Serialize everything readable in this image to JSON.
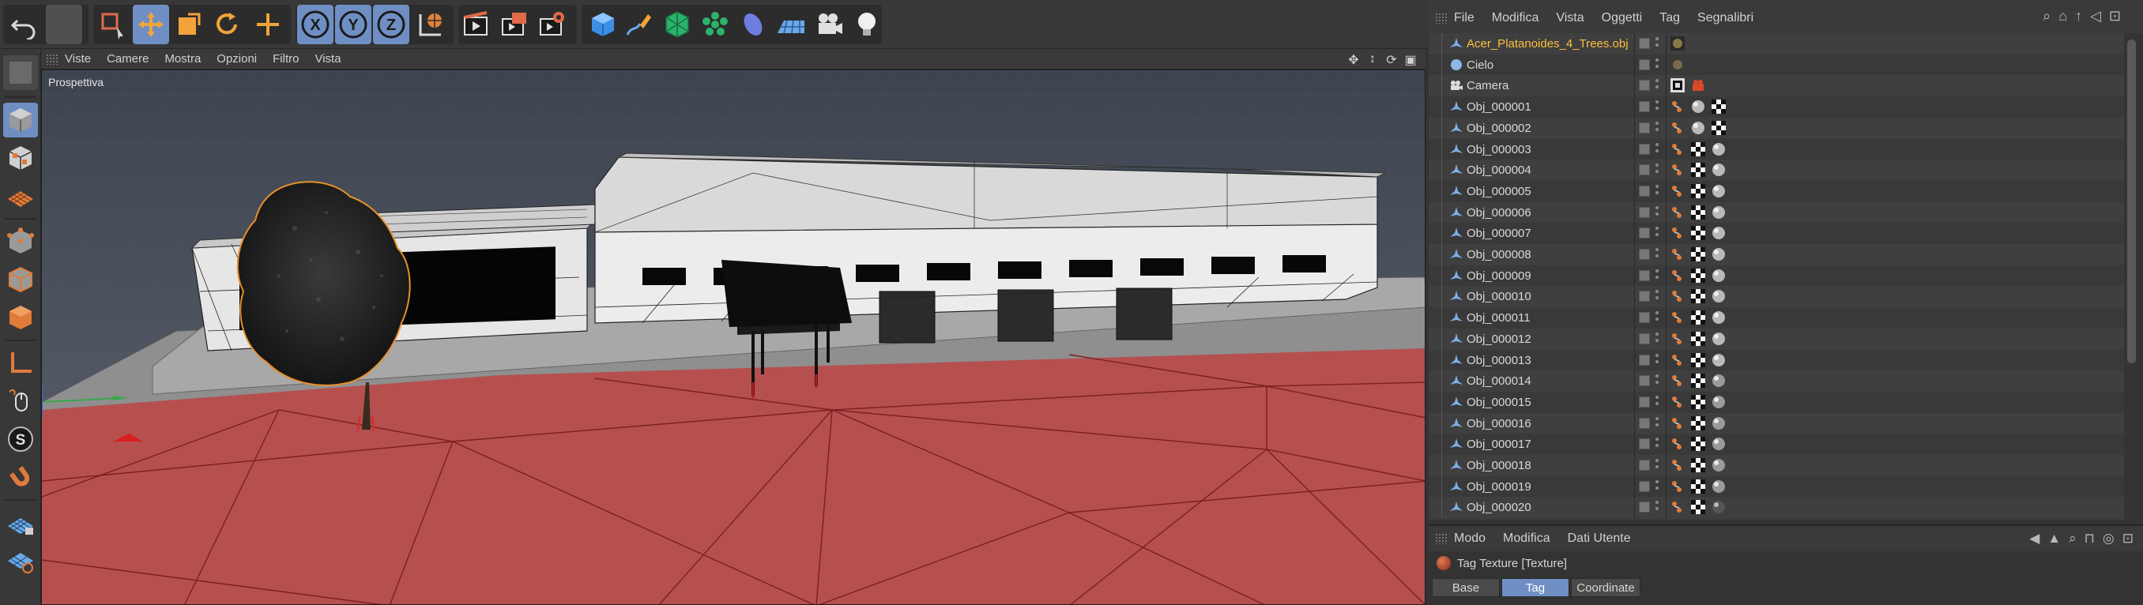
{
  "viewport": {
    "menu": [
      "Viste",
      "Camere",
      "Mostra",
      "Opzioni",
      "Filtro",
      "Vista"
    ],
    "label": "Prospettiva"
  },
  "object_manager": {
    "menu": [
      "File",
      "Modifica",
      "Vista",
      "Oggetti",
      "Tag",
      "Segnalibri"
    ],
    "objects": [
      {
        "name": "Acer_Platanoides_4_Trees.obj",
        "selected": true,
        "icon": "null-object-icon",
        "tags": [
          "texture-preview-icon"
        ]
      },
      {
        "name": "Cielo",
        "selected": false,
        "icon": "sky-icon",
        "tags": [
          "sky-texture-icon"
        ]
      },
      {
        "name": "Camera",
        "selected": false,
        "icon": "camera-icon",
        "tags": [
          "target-tag-icon",
          "protection-tag-icon"
        ]
      },
      {
        "name": "Obj_000001",
        "selected": false,
        "icon": "polygon-object-icon",
        "tags": [
          "phong-tag-icon",
          "material-icon",
          "checker-material-icon"
        ]
      },
      {
        "name": "Obj_000002",
        "selected": false,
        "icon": "polygon-object-icon",
        "tags": [
          "phong-tag-icon",
          "material-icon",
          "checker-material-icon"
        ]
      },
      {
        "name": "Obj_000003",
        "selected": false,
        "icon": "polygon-object-icon",
        "tags": [
          "phong-tag-icon",
          "checker-material-icon",
          "material-icon"
        ]
      },
      {
        "name": "Obj_000004",
        "selected": false,
        "icon": "polygon-object-icon",
        "tags": [
          "phong-tag-icon",
          "checker-material-icon",
          "material-icon"
        ]
      },
      {
        "name": "Obj_000005",
        "selected": false,
        "icon": "polygon-object-icon",
        "tags": [
          "phong-tag-icon",
          "checker-material-icon",
          "material-icon"
        ]
      },
      {
        "name": "Obj_000006",
        "selected": false,
        "icon": "polygon-object-icon",
        "tags": [
          "phong-tag-icon",
          "checker-material-icon",
          "material-icon"
        ]
      },
      {
        "name": "Obj_000007",
        "selected": false,
        "icon": "polygon-object-icon",
        "tags": [
          "phong-tag-icon",
          "checker-material-icon",
          "material-icon"
        ]
      },
      {
        "name": "Obj_000008",
        "selected": false,
        "icon": "polygon-object-icon",
        "tags": [
          "phong-tag-icon",
          "checker-material-icon",
          "material-icon"
        ]
      },
      {
        "name": "Obj_000009",
        "selected": false,
        "icon": "polygon-object-icon",
        "tags": [
          "phong-tag-icon",
          "checker-material-icon",
          "material-icon"
        ]
      },
      {
        "name": "Obj_000010",
        "selected": false,
        "icon": "polygon-object-icon",
        "tags": [
          "phong-tag-icon",
          "checker-material-icon",
          "material-icon"
        ]
      },
      {
        "name": "Obj_000011",
        "selected": false,
        "icon": "polygon-object-icon",
        "tags": [
          "phong-tag-icon",
          "checker-material-icon",
          "material-icon"
        ]
      },
      {
        "name": "Obj_000012",
        "selected": false,
        "icon": "polygon-object-icon",
        "tags": [
          "phong-tag-icon",
          "checker-material-icon",
          "material-icon"
        ]
      },
      {
        "name": "Obj_000013",
        "selected": false,
        "icon": "polygon-object-icon",
        "tags": [
          "phong-tag-icon",
          "checker-material-icon",
          "material-icon"
        ]
      },
      {
        "name": "Obj_000014",
        "selected": false,
        "icon": "polygon-object-icon",
        "tags": [
          "phong-tag-icon",
          "checker-material-icon",
          "sphere-material-icon"
        ]
      },
      {
        "name": "Obj_000015",
        "selected": false,
        "icon": "polygon-object-icon",
        "tags": [
          "phong-tag-icon",
          "checker-material-icon",
          "sphere-material-icon"
        ]
      },
      {
        "name": "Obj_000016",
        "selected": false,
        "icon": "polygon-object-icon",
        "tags": [
          "phong-tag-icon",
          "checker-material-icon",
          "sphere-material-icon"
        ]
      },
      {
        "name": "Obj_000017",
        "selected": false,
        "icon": "polygon-object-icon",
        "tags": [
          "phong-tag-icon",
          "checker-material-icon",
          "sphere-material-icon"
        ]
      },
      {
        "name": "Obj_000018",
        "selected": false,
        "icon": "polygon-object-icon",
        "tags": [
          "phong-tag-icon",
          "checker-material-icon",
          "sphere-material-icon"
        ]
      },
      {
        "name": "Obj_000019",
        "selected": false,
        "icon": "polygon-object-icon",
        "tags": [
          "phong-tag-icon",
          "checker-material-icon",
          "sphere-material-icon"
        ]
      },
      {
        "name": "Obj_000020",
        "selected": false,
        "icon": "polygon-object-icon",
        "tags": [
          "phong-tag-icon",
          "checker-material-icon",
          "dark-sphere-material-icon"
        ]
      }
    ]
  },
  "attribute_manager": {
    "menu": [
      "Modo",
      "Modifica",
      "Dati Utente"
    ],
    "title": "Tag Texture [Texture]",
    "tabs": [
      "Base",
      "Tag",
      "Coordinate"
    ],
    "active_tab": "Tag"
  },
  "toolbar": {
    "icons": [
      "undo-icon",
      "redo-icon",
      "live-selection-icon",
      "move-icon",
      "scale-icon",
      "rotate-icon",
      "recent-tool-icon",
      "x-axis-lock-icon",
      "y-axis-lock-icon",
      "z-axis-lock-icon",
      "coordinate-system-icon",
      "render-view-icon",
      "render-picture-viewer-icon",
      "render-settings-icon",
      "cube-icon",
      "pen-spline-icon",
      "subdivision-icon",
      "cloner-icon",
      "deformer-icon",
      "floor-icon",
      "camera-icon",
      "light-icon"
    ],
    "active": [
      "move-icon",
      "x-axis-lock-icon",
      "y-axis-lock-icon",
      "z-axis-lock-icon"
    ]
  },
  "colors": {
    "accent": "#6f8fc4",
    "selected_text": "#ffbf3c",
    "floor": "#b5504f"
  }
}
